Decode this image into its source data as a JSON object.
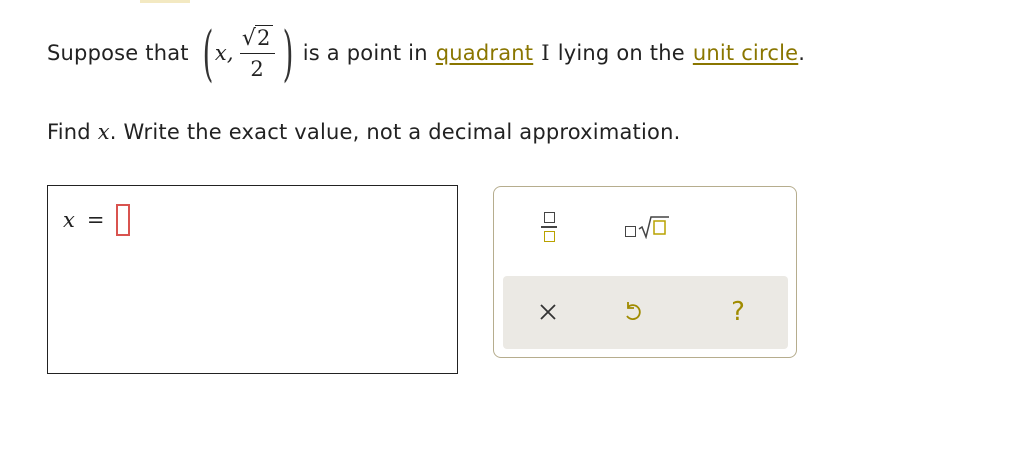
{
  "question": {
    "prefix": "Suppose that",
    "var_x": "x,",
    "sqrt_value": "2",
    "denominator": "2",
    "middle": "is a point in",
    "link_quadrant": "quadrant",
    "roman": "I",
    "middle2": "lying on the",
    "link_unit_circle": "unit circle",
    "period": "."
  },
  "instruction": {
    "find": "Find",
    "var": "x",
    "rest": ". Write the exact value, not a decimal approximation."
  },
  "answer": {
    "var": "x",
    "equals": "="
  },
  "palette": {
    "tools": [
      {
        "name": "fraction-icon"
      },
      {
        "name": "sqrt-icon"
      }
    ],
    "clear_label": "×",
    "undo_label": "undo-icon",
    "help_label": "?",
    "accent_color": "#b9a200"
  },
  "colors": {
    "link": "#8a7600",
    "cursor": "#d9534f",
    "bar_bg": "#ebe9e4"
  }
}
